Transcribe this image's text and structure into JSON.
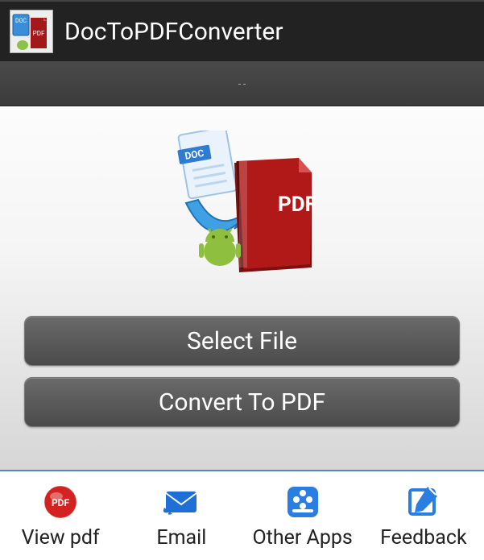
{
  "app": {
    "title": "DocToPDFConverter"
  },
  "status": {
    "text": "- -"
  },
  "hero": {
    "doc_badge": "DOC",
    "pdf_badge": "PDF"
  },
  "buttons": {
    "select_file": "Select File",
    "convert": "Convert To PDF"
  },
  "nav": {
    "view_pdf": {
      "label": "View pdf",
      "badge": "PDF"
    },
    "email": {
      "label": "Email"
    },
    "other_apps": {
      "label": "Other Apps"
    },
    "feedback": {
      "label": "Feedback"
    }
  }
}
